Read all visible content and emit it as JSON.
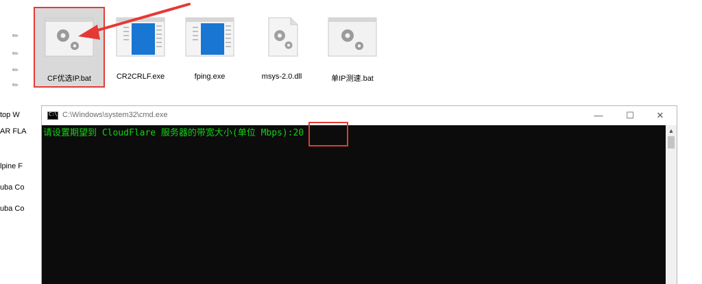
{
  "files": [
    {
      "name": "CF优选IP.bat",
      "icon": "batch-gear-icon",
      "selected": true
    },
    {
      "name": "CR2CRLF.exe",
      "icon": "exe-window-icon"
    },
    {
      "name": "fping.exe",
      "icon": "exe-window-icon"
    },
    {
      "name": "msys-2.0.dll",
      "icon": "dll-gear-icon"
    },
    {
      "name": "单IP测速.bat",
      "icon": "batch-gear-icon"
    }
  ],
  "nav": {
    "items": [
      "top W",
      "AR FLA",
      "lpine F",
      "uba Co",
      "uba Co"
    ]
  },
  "cmd": {
    "title": "C:\\Windows\\system32\\cmd.exe",
    "prompt": "请设置期望到 CloudFlare 服务器的带宽大小(单位 Mbps):",
    "input": "20",
    "minimize": "—",
    "maximize": "☐",
    "close": "✕"
  },
  "colors": {
    "highlight": "#e53935",
    "console_bg": "#0c0c0c",
    "console_text": "#13d213",
    "selected_bg": "#d9d9d9"
  }
}
